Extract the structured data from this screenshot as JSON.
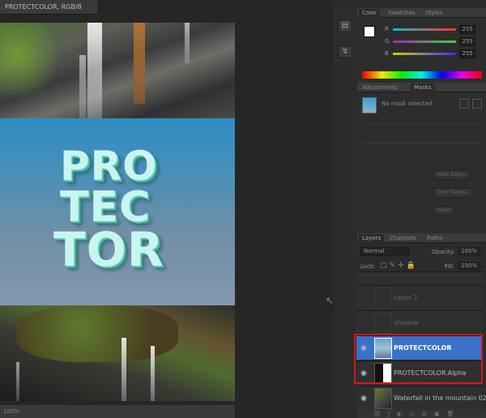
{
  "document": {
    "tab_title": "PROTECTCOLOR, RGB/8"
  },
  "poster": {
    "line1": "PRO",
    "line2": "TEC",
    "line3": "TOR"
  },
  "color_panel": {
    "tabs": [
      "Color",
      "Swatches",
      "Styles"
    ],
    "sliders": [
      {
        "label": "R",
        "value": "255"
      },
      {
        "label": "G",
        "value": "255"
      },
      {
        "label": "B",
        "value": "255"
      }
    ]
  },
  "masks_panel": {
    "tabs": [
      "Adjustments",
      "Masks"
    ],
    "status": "No mask selected",
    "buttons": [
      "Mask Edge...",
      "Color Range...",
      "Invert"
    ]
  },
  "layers_panel": {
    "tabs": [
      "Layers",
      "Channels",
      "Paths"
    ],
    "blend_mode": "Normal",
    "opacity_label": "Opacity:",
    "opacity_value": "100%",
    "lock_label": "Lock:",
    "fill_label": "Fill:",
    "fill_value": "100%",
    "layers": [
      {
        "name": "Layer 1",
        "thumb": "transparent"
      },
      {
        "name": "shadow",
        "thumb": "transparent"
      },
      {
        "name": "PROTECTCOLOR",
        "thumb": "poster",
        "selected": true
      },
      {
        "name": "PROTECTCOLOR.Alpha",
        "thumb": "alpha"
      },
      {
        "name": "Waterfall  in the mountain 02",
        "thumb": "photo"
      }
    ]
  },
  "status_bar": {
    "text": "100%"
  },
  "colors": {
    "selection": "#3a71c9",
    "highlight_outline": "#d8141d",
    "accent_text": "#6fd1c4"
  }
}
